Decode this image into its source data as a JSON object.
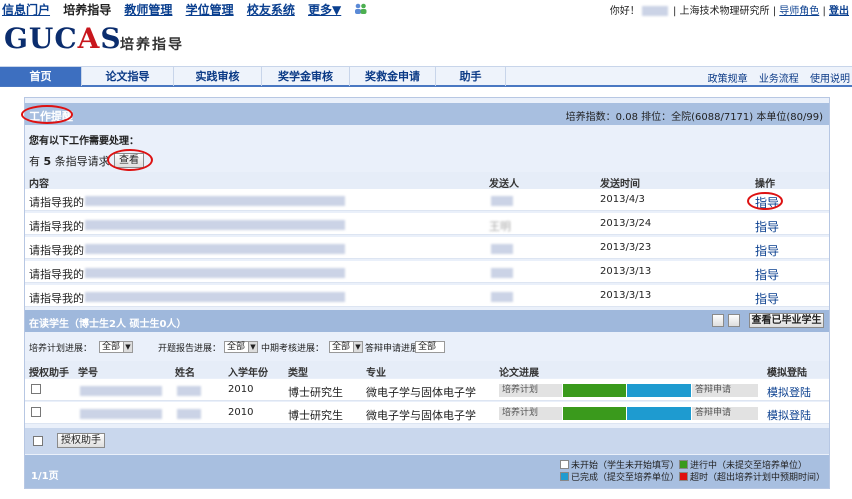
{
  "topnav": {
    "links": [
      "信息门户",
      "培养指导",
      "教师管理",
      "学位管理",
      "校友系统",
      "更多▼"
    ],
    "greeting": "你好！",
    "institute": "上海技术物理研究所",
    "separator1": "|",
    "role": "导师角色",
    "separator2": "|",
    "logout": "登出"
  },
  "logo": {
    "part1": "GUC",
    "part2": "A",
    "part3": "S",
    "subtitle": "培养指导"
  },
  "mainnav": {
    "tabs": [
      "首页",
      "论文指导",
      "实践审核",
      "奖学金审核",
      "奖救金申请",
      "助手"
    ],
    "right": [
      "政策规章",
      "业务流程",
      "使用说明"
    ]
  },
  "work": {
    "title": "工作提醒",
    "stats": "培养指数：0.08 排位：全院(6088/7171) 本单位(80/99)",
    "subtitle": "您有以下工作需要处理：",
    "pending_pre": "有",
    "pending_count": "5",
    "pending_post": "条指导请求",
    "view_button": "查看",
    "headers": {
      "content": "内容",
      "sender": "发送人",
      "time": "发送时间",
      "action": "操作"
    },
    "rows": [
      {
        "content": "请指导我的",
        "date": "2013/4/3",
        "action": "指导"
      },
      {
        "content": "请指导我的",
        "sender": "王明",
        "date": "2013/3/24",
        "action": "指导"
      },
      {
        "content": "请指导我的",
        "date": "2013/3/23",
        "action": "指导"
      },
      {
        "content": "请指导我的",
        "date": "2013/3/13",
        "action": "指导"
      },
      {
        "content": "请指导我的",
        "date": "2013/3/13",
        "action": "指导"
      }
    ]
  },
  "students": {
    "title": "在读学生（博士生2人 硕士生0人）",
    "grad_button": "查看已毕业学生",
    "filters": [
      {
        "label": "培养计划进展：",
        "value": "全部"
      },
      {
        "label": "开题报告进展：",
        "value": "全部"
      },
      {
        "label": "中期考核进展：",
        "value": "全部"
      },
      {
        "label": "答辩申请进展：",
        "value": "全部"
      }
    ],
    "headers": {
      "auth": "授权助手",
      "id": "学号",
      "name": "姓名",
      "year": "入学年份",
      "type": "类型",
      "major": "专业",
      "progress": "论文进展",
      "login": "模拟登陆"
    },
    "rows": [
      {
        "year": "2010",
        "type": "博士研究生",
        "major": "微电子学与固体电子学",
        "stage1": "培养计划",
        "stage4": "答辩申请",
        "login": "模拟登陆"
      },
      {
        "year": "2010",
        "type": "博士研究生",
        "major": "微电子学与固体电子学",
        "stage1": "培养计划",
        "stage4": "答辩申请",
        "login": "模拟登陆"
      }
    ],
    "auth_button": "授权助手",
    "page": "1/1页",
    "legend": [
      {
        "color": "#ffffff",
        "text": "未开始（学生未开始填写）"
      },
      {
        "color": "#3a9a1c",
        "text": "进行中（未提交至培养单位）"
      },
      {
        "color": "#1e9bd0",
        "text": "已完成（提交至培养单位）"
      },
      {
        "color": "#e01010",
        "text": "超时（超出培养计划中预期时间）"
      }
    ]
  },
  "colors": {
    "accent": "#3d6fc0",
    "header": "#a8bfe0",
    "inprogress": "#3a9a1c",
    "done": "#1e9bd0",
    "overdue": "#e01010",
    "annotation": "#d11111"
  }
}
